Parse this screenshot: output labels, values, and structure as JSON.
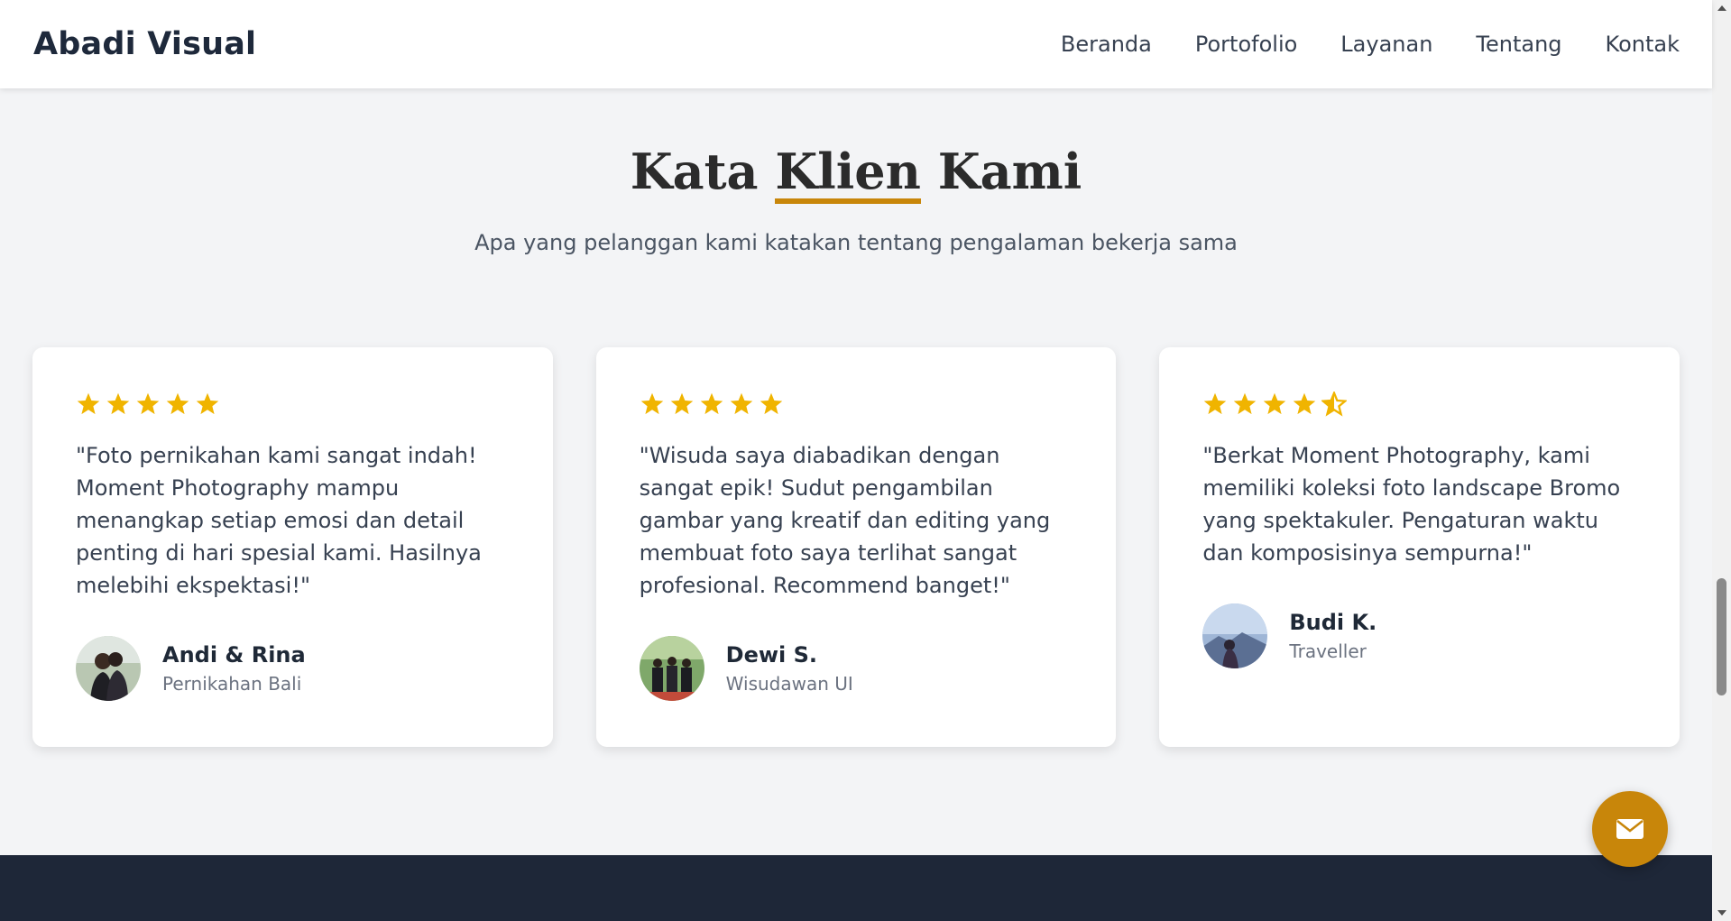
{
  "nav": {
    "brand": "Abadi Visual",
    "links": [
      "Beranda",
      "Portofolio",
      "Layanan",
      "Tentang",
      "Kontak"
    ]
  },
  "section": {
    "title_part1": "Kata ",
    "title_highlight": "Klien",
    "title_part2": " Kami",
    "subtitle": "Apa yang pelanggan kami katakan tentang pengalaman bekerja sama"
  },
  "testimonials": [
    {
      "rating": 5,
      "quote": "\"Foto pernikahan kami sangat indah! Moment Photography mampu menangkap setiap emosi dan detail penting di hari spesial kami. Hasilnya melebihi ekspektasi!\"",
      "name": "Andi & Rina",
      "role": "Pernikahan Bali"
    },
    {
      "rating": 5,
      "quote": "\"Wisuda saya diabadikan dengan sangat epik! Sudut pengambilan gambar yang kreatif dan editing yang membuat foto saya terlihat sangat profesional. Recommend banget!\"",
      "name": "Dewi S.",
      "role": "Wisudawan UI"
    },
    {
      "rating": 4.5,
      "quote": "\"Berkat Moment Photography, kami memiliki koleksi foto landscape Bromo yang spektakuler. Pengaturan waktu dan komposisinya sempurna!\"",
      "name": "Budi K.",
      "role": "Traveller"
    }
  ],
  "icons": {
    "star": "star-icon",
    "half_star": "star-half-icon",
    "contact": "envelope-icon"
  },
  "colors": {
    "accent": "#c8860a",
    "star": "#f0b400",
    "footer": "#1e2738",
    "background": "#f3f4f6"
  },
  "scroll": {
    "position": 0.75
  }
}
